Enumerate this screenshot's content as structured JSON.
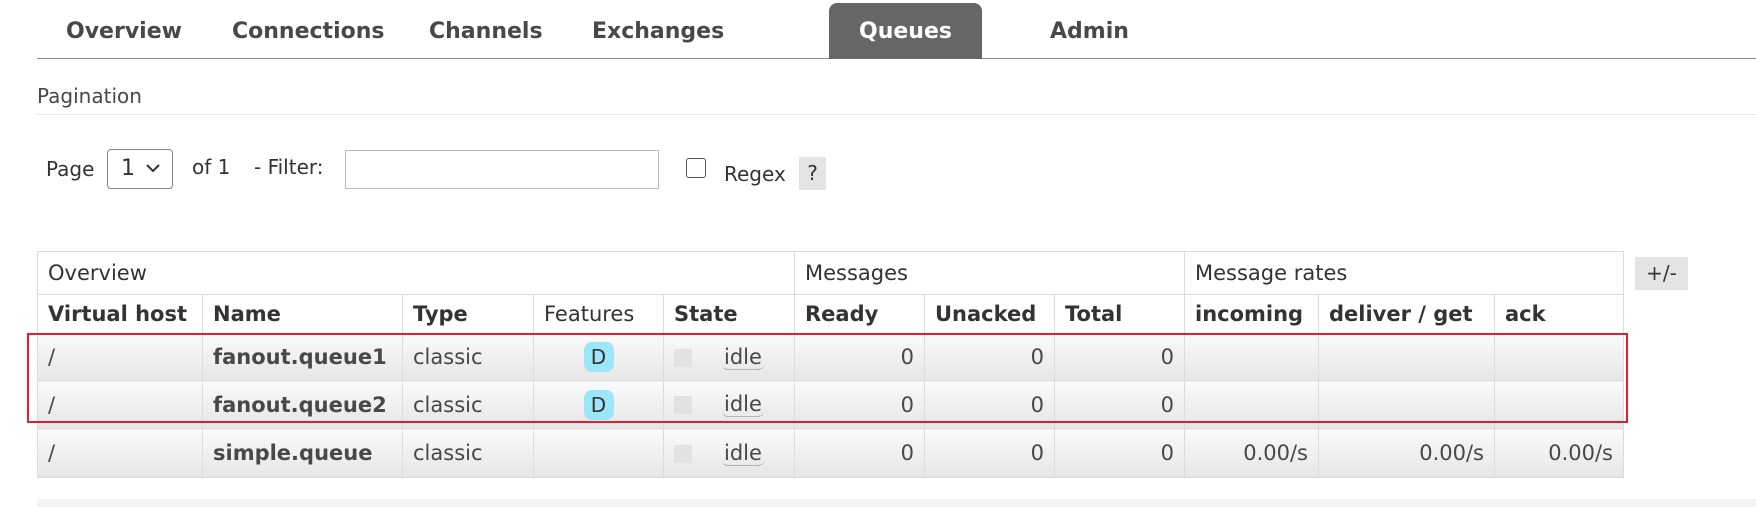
{
  "tabs": [
    {
      "label": "Overview",
      "active": false
    },
    {
      "label": "Connections",
      "active": false
    },
    {
      "label": "Channels",
      "active": false
    },
    {
      "label": "Exchanges",
      "active": false
    },
    {
      "label": "Queues",
      "active": true
    },
    {
      "label": "Admin",
      "active": false
    }
  ],
  "pagination": {
    "title": "Pagination",
    "page_label": "Page",
    "page_value": "1",
    "of_label": "of 1",
    "filter_label": "- Filter:",
    "filter_value": "",
    "regex_label": "Regex",
    "regex_checked": false,
    "help_label": "?"
  },
  "table": {
    "groups": [
      "Overview",
      "Messages",
      "Message rates"
    ],
    "columns": [
      "Virtual host",
      "Name",
      "Type",
      "Features",
      "State",
      "Ready",
      "Unacked",
      "Total",
      "incoming",
      "deliver / get",
      "ack"
    ],
    "rows": [
      {
        "vhost": "/",
        "name": "fanout.queue1",
        "type": "classic",
        "feature": "D",
        "state": "idle",
        "ready": "0",
        "unacked": "0",
        "total": "0",
        "incoming": "",
        "deliver_get": "",
        "ack": ""
      },
      {
        "vhost": "/",
        "name": "fanout.queue2",
        "type": "classic",
        "feature": "D",
        "state": "idle",
        "ready": "0",
        "unacked": "0",
        "total": "0",
        "incoming": "",
        "deliver_get": "",
        "ack": ""
      },
      {
        "vhost": "/",
        "name": "simple.queue",
        "type": "classic",
        "feature": "",
        "state": "idle",
        "ready": "0",
        "unacked": "0",
        "total": "0",
        "incoming": "0.00/s",
        "deliver_get": "0.00/s",
        "ack": "0.00/s"
      }
    ],
    "plus_minus_label": "+/-"
  },
  "colors": {
    "active_tab": "#666666",
    "durable_badge": "#9be6f8",
    "highlight_box": "#e0202a"
  }
}
